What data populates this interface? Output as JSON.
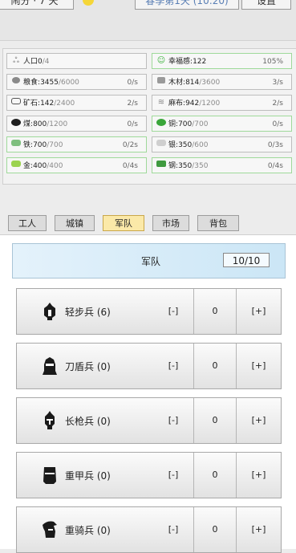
{
  "topbar": {
    "left_label": "闹分 · 7 天",
    "center_label": "春季第1天 (10:20)",
    "settings_label": "设置"
  },
  "resources": {
    "population": {
      "label": "人口",
      "value": "0",
      "max": "/4"
    },
    "happiness": {
      "label": "幸福感",
      "value": "122",
      "percent": "105%"
    },
    "items": [
      {
        "name": "粮食",
        "value": "3455",
        "max": "/6000",
        "rate": "0/s",
        "icon": "grain-icon"
      },
      {
        "name": "木材",
        "value": "814",
        "max": "/3600",
        "rate": "3/s",
        "icon": "wood-icon"
      },
      {
        "name": "矿石",
        "value": "142",
        "max": "/2400",
        "rate": "2/s",
        "icon": "ore-icon"
      },
      {
        "name": "麻布",
        "value": "942",
        "max": "/1200",
        "rate": "2/s",
        "icon": "linen-icon"
      },
      {
        "name": "煤",
        "value": "800",
        "max": "/1200",
        "rate": "0/s",
        "icon": "coal-icon"
      },
      {
        "name": "铜",
        "value": "700",
        "max": "/700",
        "rate": "0/s",
        "icon": "copper-icon"
      },
      {
        "name": "铁",
        "value": "700",
        "max": "/700",
        "rate": "0/2s",
        "icon": "iron-icon"
      },
      {
        "name": "银",
        "value": "350",
        "max": "/600",
        "rate": "0/3s",
        "icon": "silver-icon"
      },
      {
        "name": "金",
        "value": "400",
        "max": "/400",
        "rate": "0/4s",
        "icon": "gold-icon"
      },
      {
        "name": "钢",
        "value": "350",
        "max": "/350",
        "rate": "0/4s",
        "icon": "steel-icon"
      }
    ]
  },
  "tabs": [
    "工人",
    "城镇",
    "军队",
    "市场",
    "背包"
  ],
  "active_tab": "军队",
  "army": {
    "title": "军队",
    "count": "10/10",
    "units": [
      {
        "name": "轻步兵 (6)",
        "value": "0",
        "minus": "[-]",
        "plus": "[+]"
      },
      {
        "name": "刀盾兵 (0)",
        "value": "0",
        "minus": "[-]",
        "plus": "[+]"
      },
      {
        "name": "长枪兵 (0)",
        "value": "0",
        "minus": "[-]",
        "plus": "[+]"
      },
      {
        "name": "重甲兵 (0)",
        "value": "0",
        "minus": "[-]",
        "plus": "[+]"
      },
      {
        "name": "重骑兵 (0)",
        "value": "0",
        "minus": "[-]",
        "plus": "[+]"
      }
    ]
  },
  "colors": {
    "active_tab_bg": "#fbe9a8",
    "header_blue": "#cbe6f6",
    "full_border_green": "#9fd99a"
  }
}
